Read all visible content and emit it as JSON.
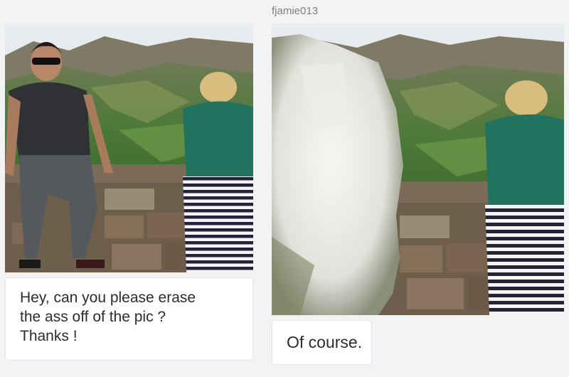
{
  "header": {
    "username": "fjamie013"
  },
  "left_message": {
    "lines": [
      "Hey, can you please erase",
      "the ass off of the pic ?",
      "Thanks !"
    ]
  },
  "right_message": {
    "text": "Of course."
  },
  "colors": {
    "page_bg": "#f2f3f5",
    "bubble_bg": "#ffffff",
    "text": "#2c2c2e",
    "username": "#7d7f84"
  },
  "photos": [
    {
      "description": "man sitting on stone wall beside woman bending over, valley landscape"
    },
    {
      "description": "same photo with man replaced by white edited area"
    }
  ]
}
